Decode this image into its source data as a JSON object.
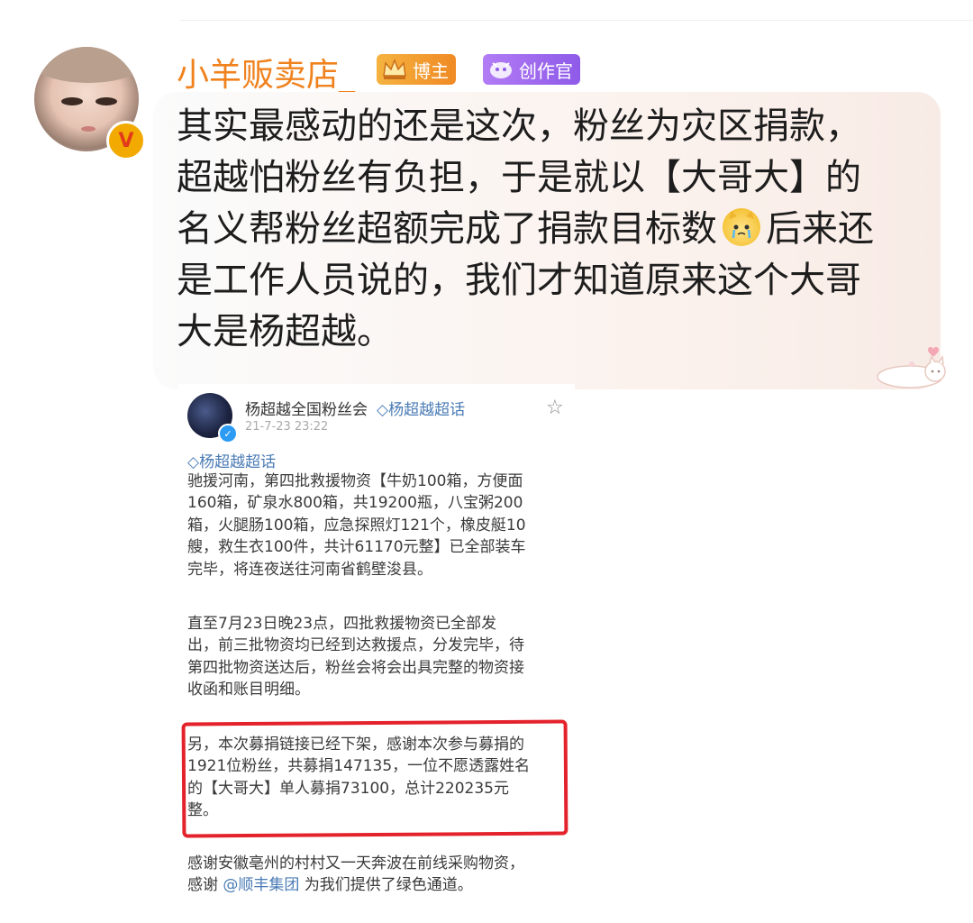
{
  "post": {
    "username": "小羊贩卖店_",
    "badges": [
      {
        "label": "博主",
        "icon": "crown-icon"
      },
      {
        "label": "创作官",
        "icon": "creator-icon"
      }
    ],
    "verified_mark": "V",
    "text_lines": [
      "其实最感动的还是这次，粉丝为灾区捐款，",
      "超越怕粉丝有负担，于是就以【大哥大】的",
      "名义帮粉丝超额完成了捐款目标数",
      "后来还",
      "是工作人员说的，我们才知道原来这个大哥",
      "大是杨超越。"
    ]
  },
  "embedded": {
    "author": "杨超越全国粉丝会",
    "topic": "杨超越超话",
    "date": "21-7-23 23:22",
    "topic_tag": "杨超越超话",
    "para1": [
      "驰援河南，第四批救援物资【牛奶100箱，方便面",
      "160箱，矿泉水800箱，共19200瓶，八宝粥200",
      "箱，火腿肠100箱，应急探照灯121个，橡皮艇10",
      "艘，救生衣100件，共计61170元整】已全部装车",
      "完毕，将连夜送往河南省鹤壁浚县。"
    ],
    "para2": [
      "直至7月23日晚23点，四批救援物资已全部发",
      "出，前三批物资均已经到达救援点，分发完毕，待",
      "第四批物资送达后，粉丝会将会出具完整的物资接",
      "收函和账目明细。"
    ],
    "para3": [
      "另，本次募捐链接已经下架，感谢本次参与募捐的",
      "1921位粉丝，共募捐147135，一位不愿透露姓名",
      "的【大哥大】单人募捐73100，总计220235元",
      "整。"
    ],
    "para4_line1": "感谢安徽亳州的村村又一天奔波在前线采购物资，",
    "para4_prefix": "感谢",
    "para4_mention": "@顺丰集团",
    "para4_suffix": "为我们提供了绿色通道。"
  },
  "colors": {
    "username": "#f0821e",
    "highlight_box": "#e3222b",
    "link": "#4a7bb5"
  }
}
